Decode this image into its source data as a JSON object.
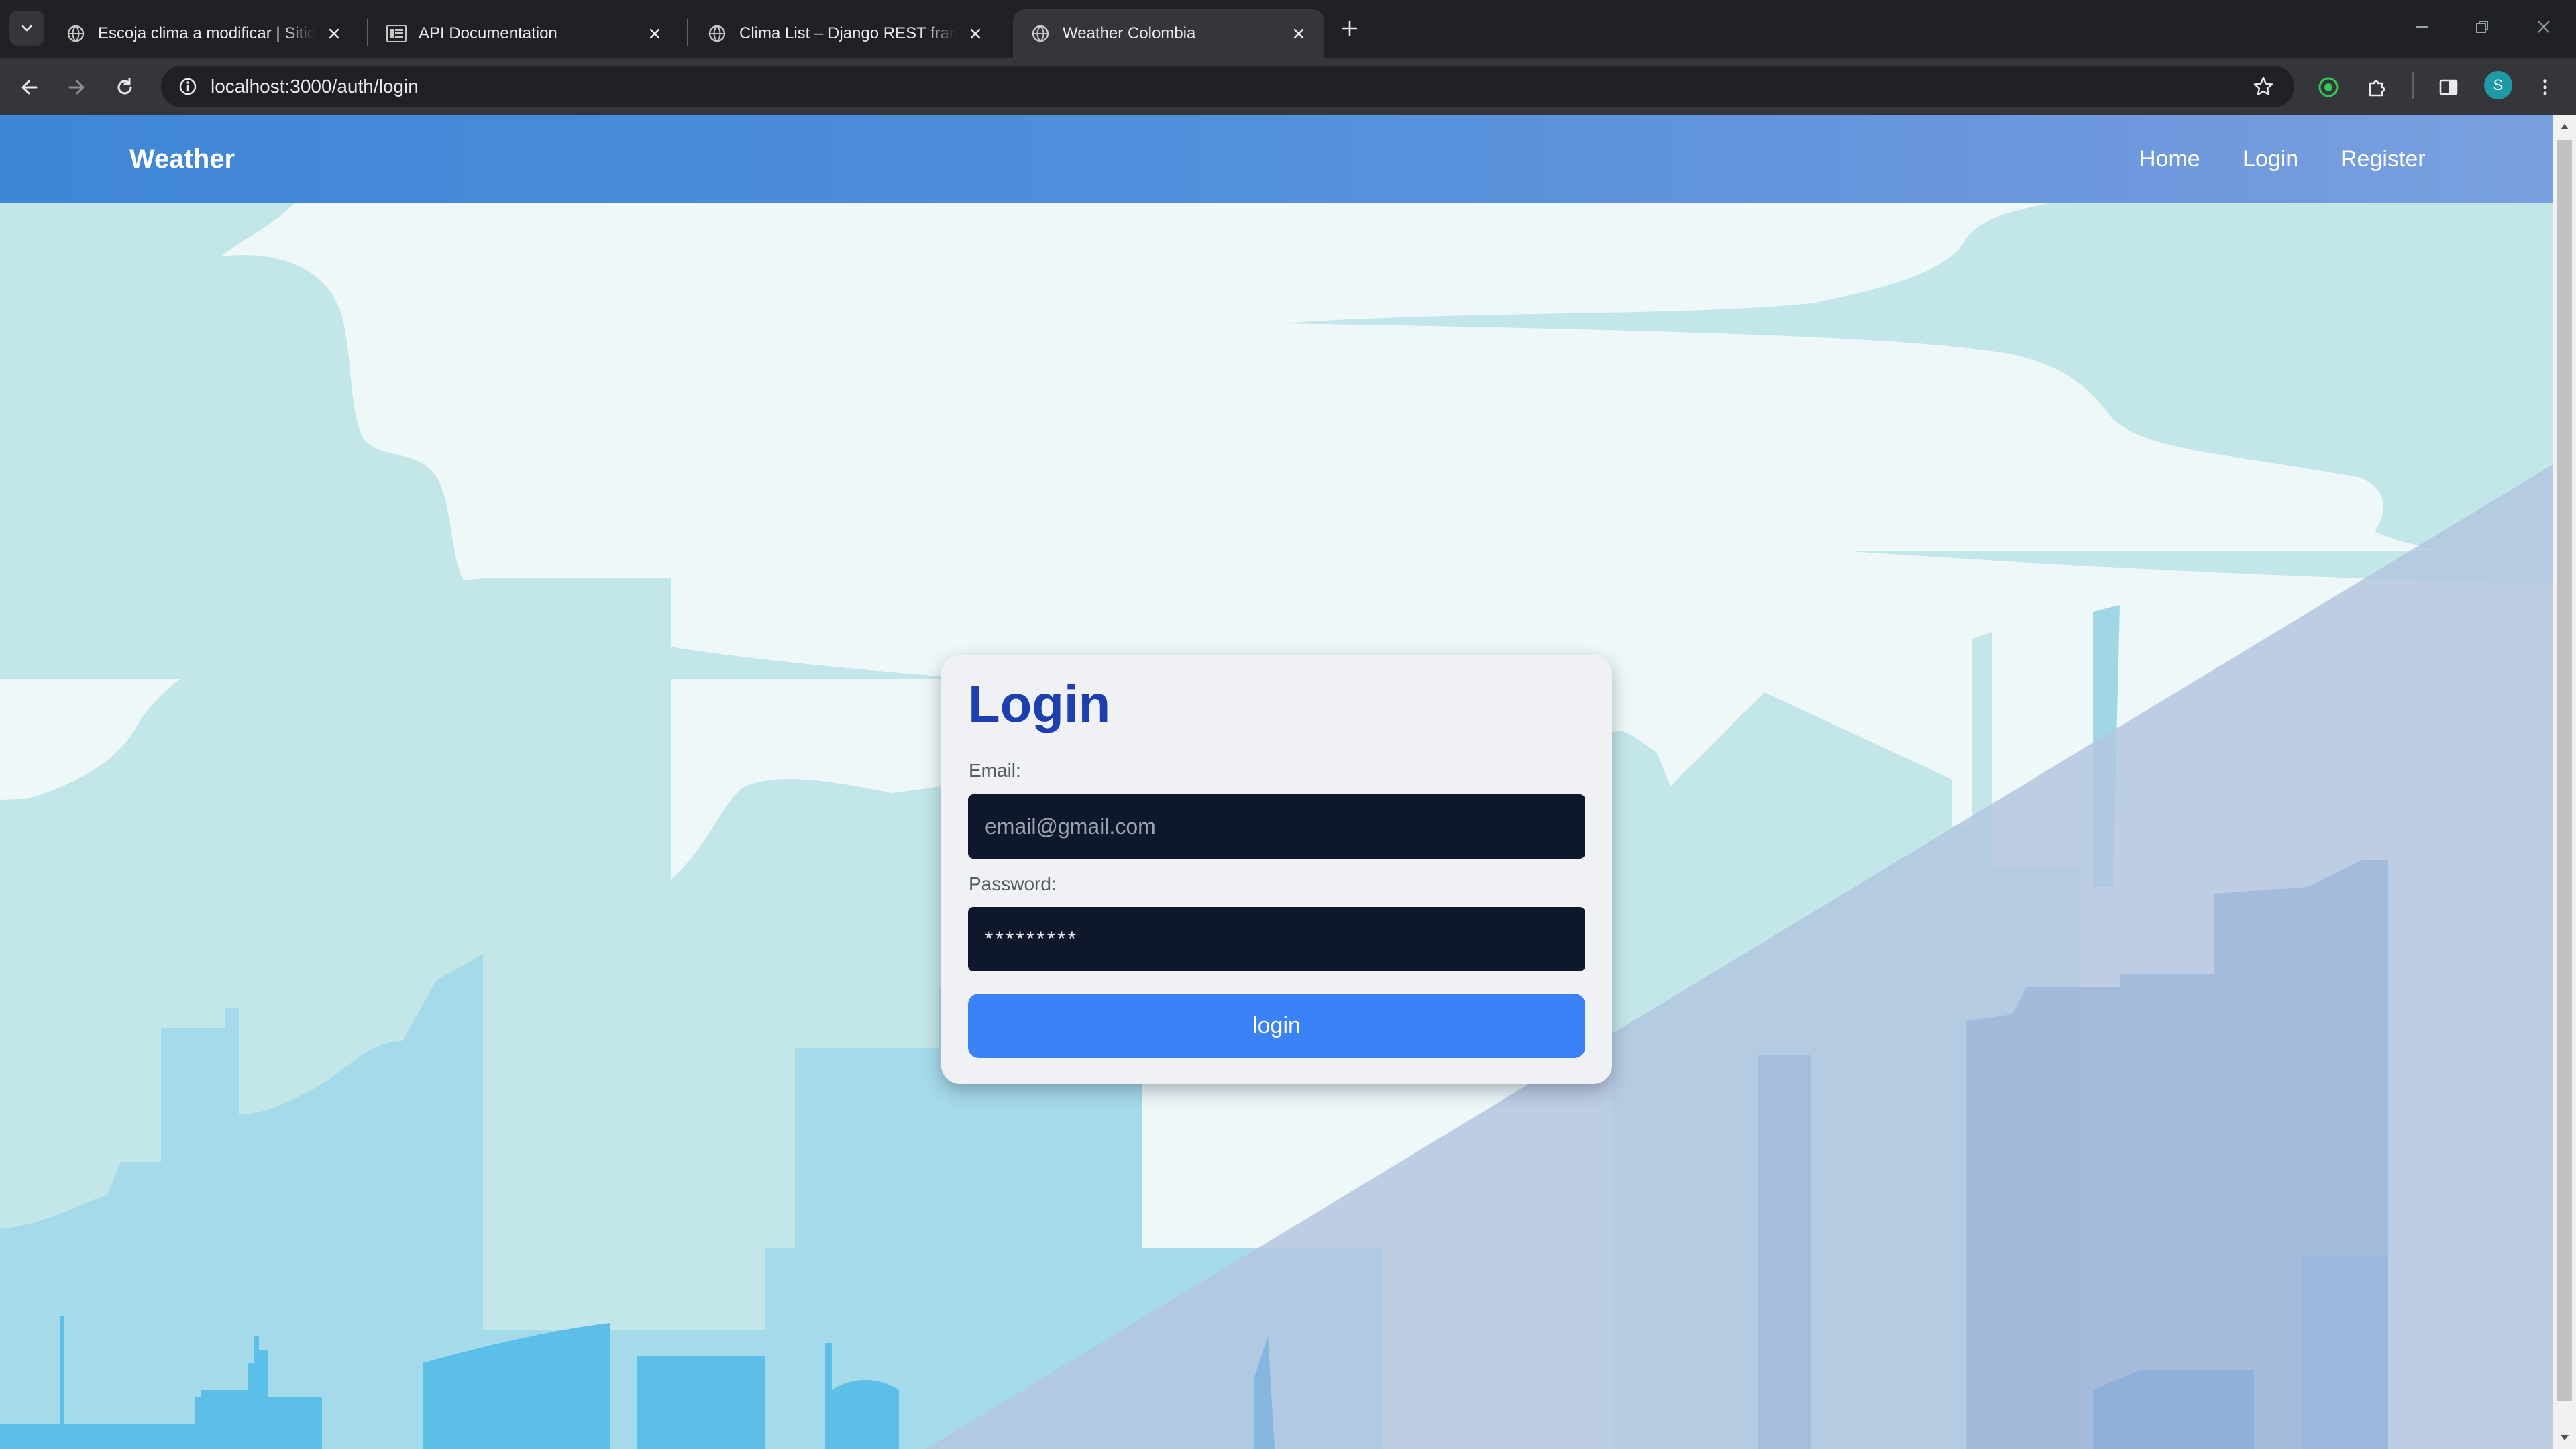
{
  "browser": {
    "tabs": [
      {
        "title": "Escoja clima a modificar | Sitio de",
        "icon": "globe-icon",
        "active": false
      },
      {
        "title": "API Documentation",
        "icon": "api-docs-icon",
        "active": false
      },
      {
        "title": "Clima List – Django REST framework",
        "icon": "globe-icon",
        "active": false
      },
      {
        "title": "Weather Colombia",
        "icon": "globe-icon",
        "active": true
      }
    ],
    "url": "localhost:3000/auth/login",
    "profile_initial": "S",
    "colors": {
      "frame": "#202124",
      "toolbar": "#35363a",
      "profile": "#1e9aa6"
    }
  },
  "navbar": {
    "brand": "Weather",
    "links": [
      "Home",
      "Login",
      "Register"
    ],
    "gradient": [
      "#3f86d6",
      "#7aa0e0"
    ]
  },
  "login_form": {
    "title": "Login",
    "email_label": "Email:",
    "email_placeholder": "email@gmail.com",
    "password_label": "Password:",
    "password_value": "*********",
    "submit_label": "login",
    "colors": {
      "title": "#1e40af",
      "input_bg": "#0f172a",
      "button": "#3b82f6"
    }
  }
}
